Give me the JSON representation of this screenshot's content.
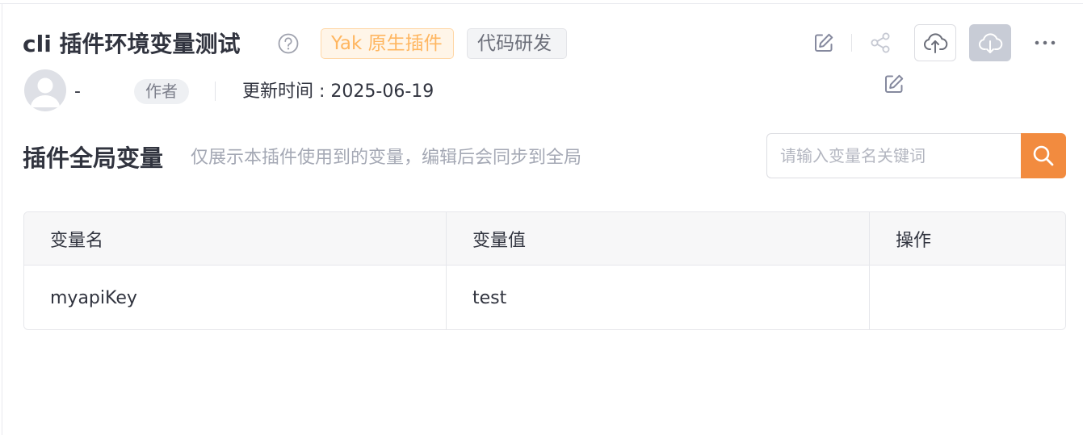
{
  "header": {
    "title": "cli 插件环境变量测试",
    "tags": [
      {
        "label": "Yak 原生插件",
        "color": "#ffb660"
      },
      {
        "label": "代码研发",
        "color": "#6c6f7a"
      }
    ],
    "actions": [
      "edit-icon",
      "share-icon",
      "cloud-upload-icon",
      "cloud-download-icon",
      "more-icon"
    ]
  },
  "author": {
    "name": "-",
    "badge": "作者",
    "update_time": "更新时间 : 2025-06-19"
  },
  "section": {
    "title": "插件全局变量",
    "description": "仅展示本插件使用到的变量，编辑后会同步到全局"
  },
  "search": {
    "placeholder": "请输入变量名关键词",
    "value": "",
    "button_color": "#f28b3f"
  },
  "table": {
    "columns": [
      "变量名",
      "变量值",
      "操作"
    ],
    "rows": [
      {
        "name": "myapiKey",
        "value": "test"
      }
    ]
  }
}
